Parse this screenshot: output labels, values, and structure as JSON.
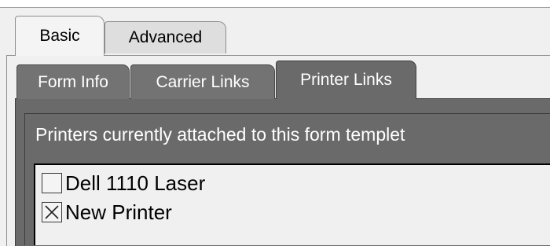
{
  "tabs": [
    {
      "label": "Basic",
      "active": true
    },
    {
      "label": "Advanced",
      "active": false
    }
  ],
  "subtabs": [
    {
      "label": "Form Info",
      "active": false
    },
    {
      "label": "Carrier Links",
      "active": false
    },
    {
      "label": "Printer Links",
      "active": true
    }
  ],
  "printers_group": {
    "title": "Printers currently attached to this form templet",
    "items": [
      {
        "label": "Dell 1110 Laser",
        "checked": false
      },
      {
        "label": "New Printer",
        "checked": true
      }
    ]
  },
  "colors": {
    "panel_background": "#6a6a6a",
    "window_background": "#f0f0f0"
  }
}
